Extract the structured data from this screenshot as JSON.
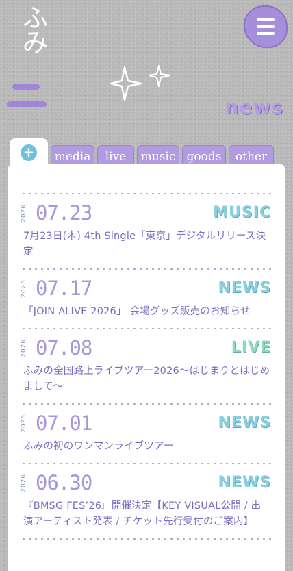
{
  "logo": {
    "text": "ふみ"
  },
  "header": {
    "menu_icon": "hamburger-menu-icon"
  },
  "section": {
    "title": "news"
  },
  "tabs": {
    "all_icon": "+",
    "items": [
      {
        "label": "media"
      },
      {
        "label": "live"
      },
      {
        "label": "music"
      },
      {
        "label": "goods"
      },
      {
        "label": "other"
      }
    ]
  },
  "news": [
    {
      "year": "2026",
      "date": "07.23",
      "category": "MUSIC",
      "title": "7月23日(木) 4th Single「東京」デジタルリリース決定",
      "color": "#88cfe0"
    },
    {
      "year": "2026",
      "date": "07.17",
      "category": "NEWS",
      "title": "「JOIN ALIVE 2026」 会場グッズ販売のお知らせ",
      "color": "#88cfe0"
    },
    {
      "year": "2026",
      "date": "07.08",
      "category": "LIVE",
      "title": "ふみの全国路上ライブツアー2026〜はじまりとはじめまして〜",
      "color": "#8ed8c0"
    },
    {
      "year": "2026",
      "date": "07.01",
      "category": "NEWS",
      "title": "ふみの初のワンマンライブツアー",
      "color": "#88cfe0"
    },
    {
      "year": "2026",
      "date": "06.30",
      "category": "NEWS",
      "title": "『BMSG FES’26』開催決定【KEY VISUAL公開 / 出演アーティスト発表 / チケット先行受付のご案内】",
      "color": "#88cfe0"
    }
  ],
  "colors": {
    "accent": "#a58fd8",
    "tab": "#b29be0",
    "category": "#88cfe0",
    "live": "#8ed8c0"
  }
}
